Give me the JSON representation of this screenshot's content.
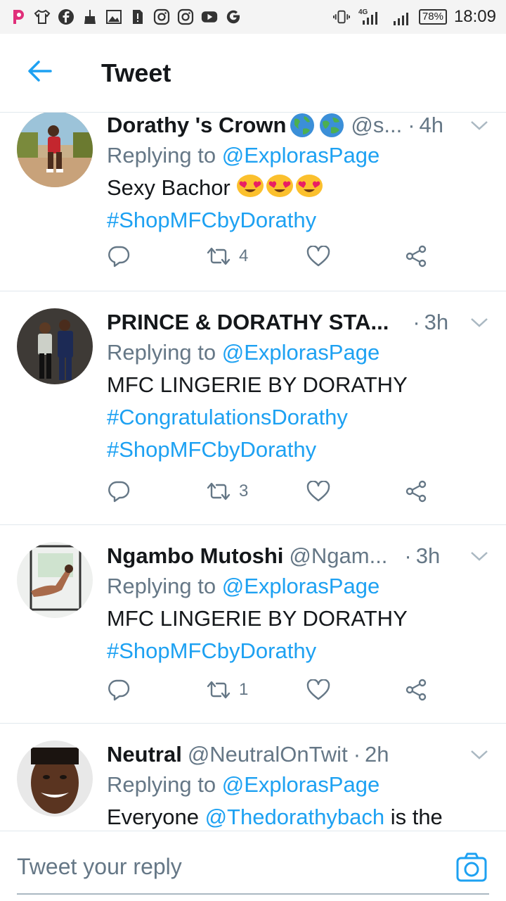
{
  "status_bar": {
    "time": "18:09",
    "battery": "78%",
    "network": "4G",
    "left_icons": [
      "picsart-icon",
      "tshirt-icon",
      "facebook-icon",
      "broom-icon",
      "image-icon",
      "sim-alert-icon",
      "instagram-icon",
      "instagram-icon-2",
      "youtube-icon",
      "google-icon"
    ]
  },
  "header": {
    "title": "Tweet"
  },
  "accent_color": "#1da1f2",
  "tweets": [
    {
      "name": "Dorathy 's Crown",
      "handle": "@s...",
      "time": "4h",
      "replying_prefix": "Replying to ",
      "replying_to": "@ExplorasPage",
      "text": "Sexy Bachor",
      "emojis": [
        "heart-eyes-emoji",
        "heart-eyes-emoji",
        "heart-eyes-emoji"
      ],
      "hashtags": [
        "#ShopMFCbyDorathy"
      ],
      "retweets": "4"
    },
    {
      "name": "PRINCE & DORATHY STA...",
      "handle": "",
      "time": "3h",
      "replying_prefix": "Replying to ",
      "replying_to": "@ExplorasPage",
      "text": "MFC LINGERIE BY DORATHY",
      "hashtags": [
        "#CongratulationsDorathy",
        "#ShopMFCbyDorathy"
      ],
      "retweets": "3"
    },
    {
      "name": "Ngambo Mutoshi",
      "handle": "@Ngam...",
      "time": "3h",
      "replying_prefix": "Replying to ",
      "replying_to": "@ExplorasPage",
      "text": "MFC LINGERIE BY DORATHY",
      "hashtags": [
        "#ShopMFCbyDorathy"
      ],
      "retweets": "1"
    },
    {
      "name": "Neutral",
      "handle": "@NeutralOnTwit",
      "time": "2h",
      "replying_prefix": "Replying to ",
      "replying_to": "@ExplorasPage",
      "text_before": "Everyone ",
      "text_mention": "@Thedorathybach",
      "text_after": " is the"
    }
  ],
  "reply_bar": {
    "placeholder": "Tweet your reply"
  }
}
